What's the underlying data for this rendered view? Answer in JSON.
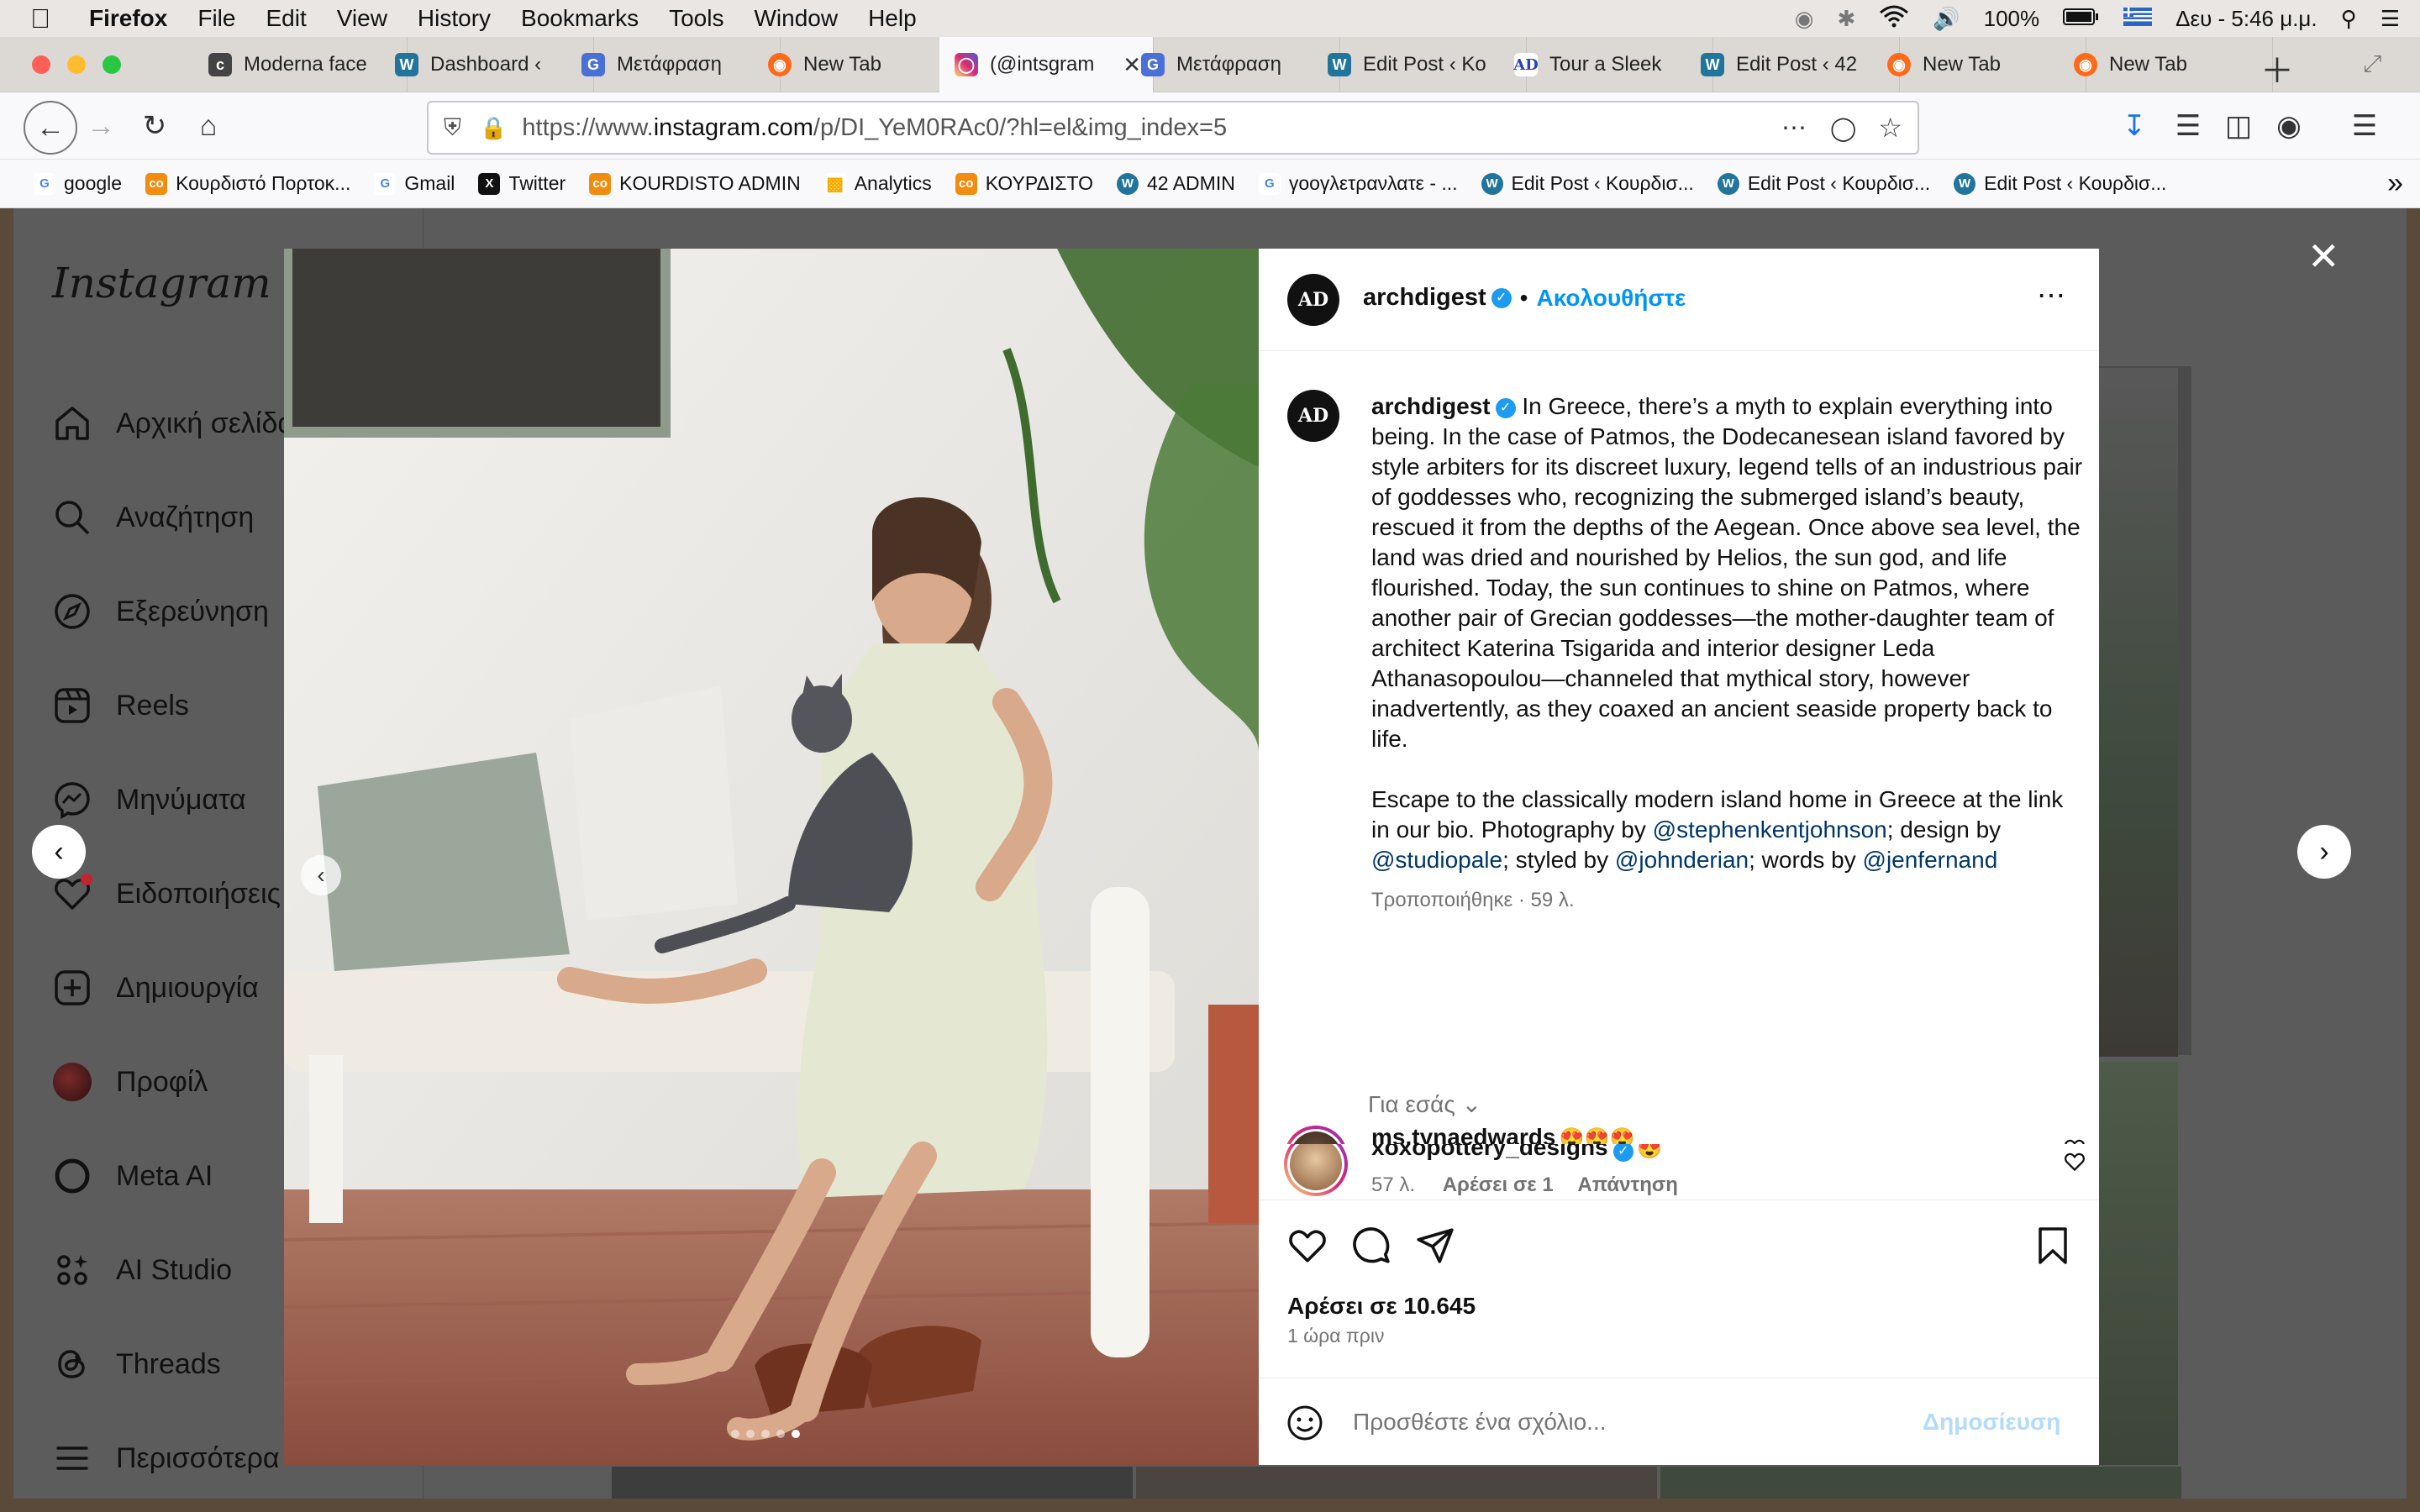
{
  "menubar": {
    "app": "Firefox",
    "items": [
      "File",
      "Edit",
      "View",
      "History",
      "Bookmarks",
      "Tools",
      "Window",
      "Help"
    ],
    "battery": "100%",
    "clock": "Δευ - 5:46 μ.μ."
  },
  "tabs": [
    {
      "label": "Moderna face",
      "icon": "c",
      "color": "#444"
    },
    {
      "label": "Dashboard ‹",
      "icon": "W",
      "color": "#21759b"
    },
    {
      "label": "Μετάφραση",
      "icon": "G",
      "color": "#4a6fd6"
    },
    {
      "label": "New Tab",
      "icon": "ff",
      "color": "#ff6a1a"
    },
    {
      "label": "(@intsgram",
      "icon": "ig",
      "color": "#d6249f"
    },
    {
      "label": "Μετάφραση",
      "icon": "G",
      "color": "#4a6fd6"
    },
    {
      "label": "Edit Post ‹ Ko",
      "icon": "W",
      "color": "#21759b"
    },
    {
      "label": "Tour a Sleek",
      "icon": "AD",
      "color": "#2a44b5"
    },
    {
      "label": "Edit Post ‹ 42",
      "icon": "W",
      "color": "#21759b"
    },
    {
      "label": "New Tab",
      "icon": "ff",
      "color": "#ff6a1a"
    },
    {
      "label": "New Tab",
      "icon": "ff",
      "color": "#ff6a1a"
    }
  ],
  "url": {
    "prefix": "https://www.",
    "domain": "instagram.com",
    "path": "/p/DI_YeM0RAc0/?hl=el&img_index=5"
  },
  "bookmarks": [
    {
      "label": "google",
      "icon": "G",
      "color": "#4285f4"
    },
    {
      "label": "Κουρδιστό Πορτοκ...",
      "icon": "co",
      "color": "#f28c0f"
    },
    {
      "label": "Gmail",
      "icon": "G",
      "color": "#4285f4"
    },
    {
      "label": "Twitter",
      "icon": "X",
      "color": "#111"
    },
    {
      "label": "KOURDISTO ADMIN",
      "icon": "co",
      "color": "#f28c0f"
    },
    {
      "label": "Analytics",
      "icon": "▂",
      "color": "#f9ab00"
    },
    {
      "label": "ΚΟΥΡΔΙΣΤΟ",
      "icon": "co",
      "color": "#f28c0f"
    },
    {
      "label": "42 ADMIN",
      "icon": "W",
      "color": "#21759b"
    },
    {
      "label": "γοογλετρανλατε - ...",
      "icon": "G",
      "color": "#4285f4"
    },
    {
      "label": "Edit Post ‹ Κουρδισ...",
      "icon": "W",
      "color": "#21759b"
    },
    {
      "label": "Edit Post ‹ Κουρδισ...",
      "icon": "W",
      "color": "#21759b"
    },
    {
      "label": "Edit Post ‹ Κουρδισ...",
      "icon": "W",
      "color": "#21759b"
    }
  ],
  "instagram": {
    "logo": "Instagram",
    "nav": [
      {
        "label": "Αρχική σελίδα",
        "icon": "home-icon"
      },
      {
        "label": "Αναζήτηση",
        "icon": "search-icon"
      },
      {
        "label": "Εξερεύνηση",
        "icon": "compass-icon"
      },
      {
        "label": "Reels",
        "icon": "reels-icon"
      },
      {
        "label": "Μηνύματα",
        "icon": "messenger-icon"
      },
      {
        "label": "Ειδοποιήσεις",
        "icon": "heart-icon"
      },
      {
        "label": "Δημιουργία",
        "icon": "plus-square-icon"
      },
      {
        "label": "Προφίλ",
        "icon": "profile-avatar-icon"
      },
      {
        "label": "Meta AI",
        "icon": "meta-ai-icon"
      },
      {
        "label": "AI Studio",
        "icon": "ai-studio-icon"
      },
      {
        "label": "Threads",
        "icon": "threads-icon"
      },
      {
        "label": "Περισσότερα",
        "icon": "menu-icon"
      }
    ],
    "post": {
      "author": "archdigest",
      "avatar_text": "AD",
      "follow": "Ακολουθήστε",
      "caption_p1": "In Greece, there’s a myth to explain everything into being. In the case of Patmos, the Dodecanesean island favored by style arbiters for its discreet luxury, legend tells of an industrious pair of goddesses who, recognizing the submerged island’s beauty, rescued it from the depths of the Aegean. Once above sea level, the land was dried and nourished by Helios, the sun god, and life flourished. Today, the sun continues to shine on Patmos, where another pair of Grecian goddesses—the mother-daughter team of architect Katerina Tsigarida and interior designer Leda Athanasopoulou—channeled that mythical story, however inadvertently, as they coaxed an ancient seaside property back to life.",
      "caption_p2_a": "Escape to the classically modern island home in Greece at the link in our bio. Photography by ",
      "mention1": "@stephenkentjohnson",
      "caption_p2_b": "; design by ",
      "mention2": "@studiopale",
      "caption_p2_c": "; styled by ",
      "mention3": "@johnderian",
      "caption_p2_d": "; words by ",
      "mention4": "@jenfernand",
      "edited": "Τροποποιήθηκε · 59 λ.",
      "for_you": "Για εσάς",
      "comments": [
        {
          "user": "xoxopottery_designs",
          "text": "😍",
          "time": "57 λ.",
          "likes": "Αρέσει σε 1",
          "reply": "Απάντηση"
        },
        {
          "user": "ms.tynaedwards",
          "text": "😍😍😍"
        }
      ],
      "likes": "Αρέσει σε 10.645",
      "posted": "1 ώρα πριν",
      "comment_placeholder": "Προσθέστε ένα σχόλιο...",
      "post_button": "Δημοσίευση",
      "carousel_count": 5,
      "carousel_active": 5
    }
  }
}
